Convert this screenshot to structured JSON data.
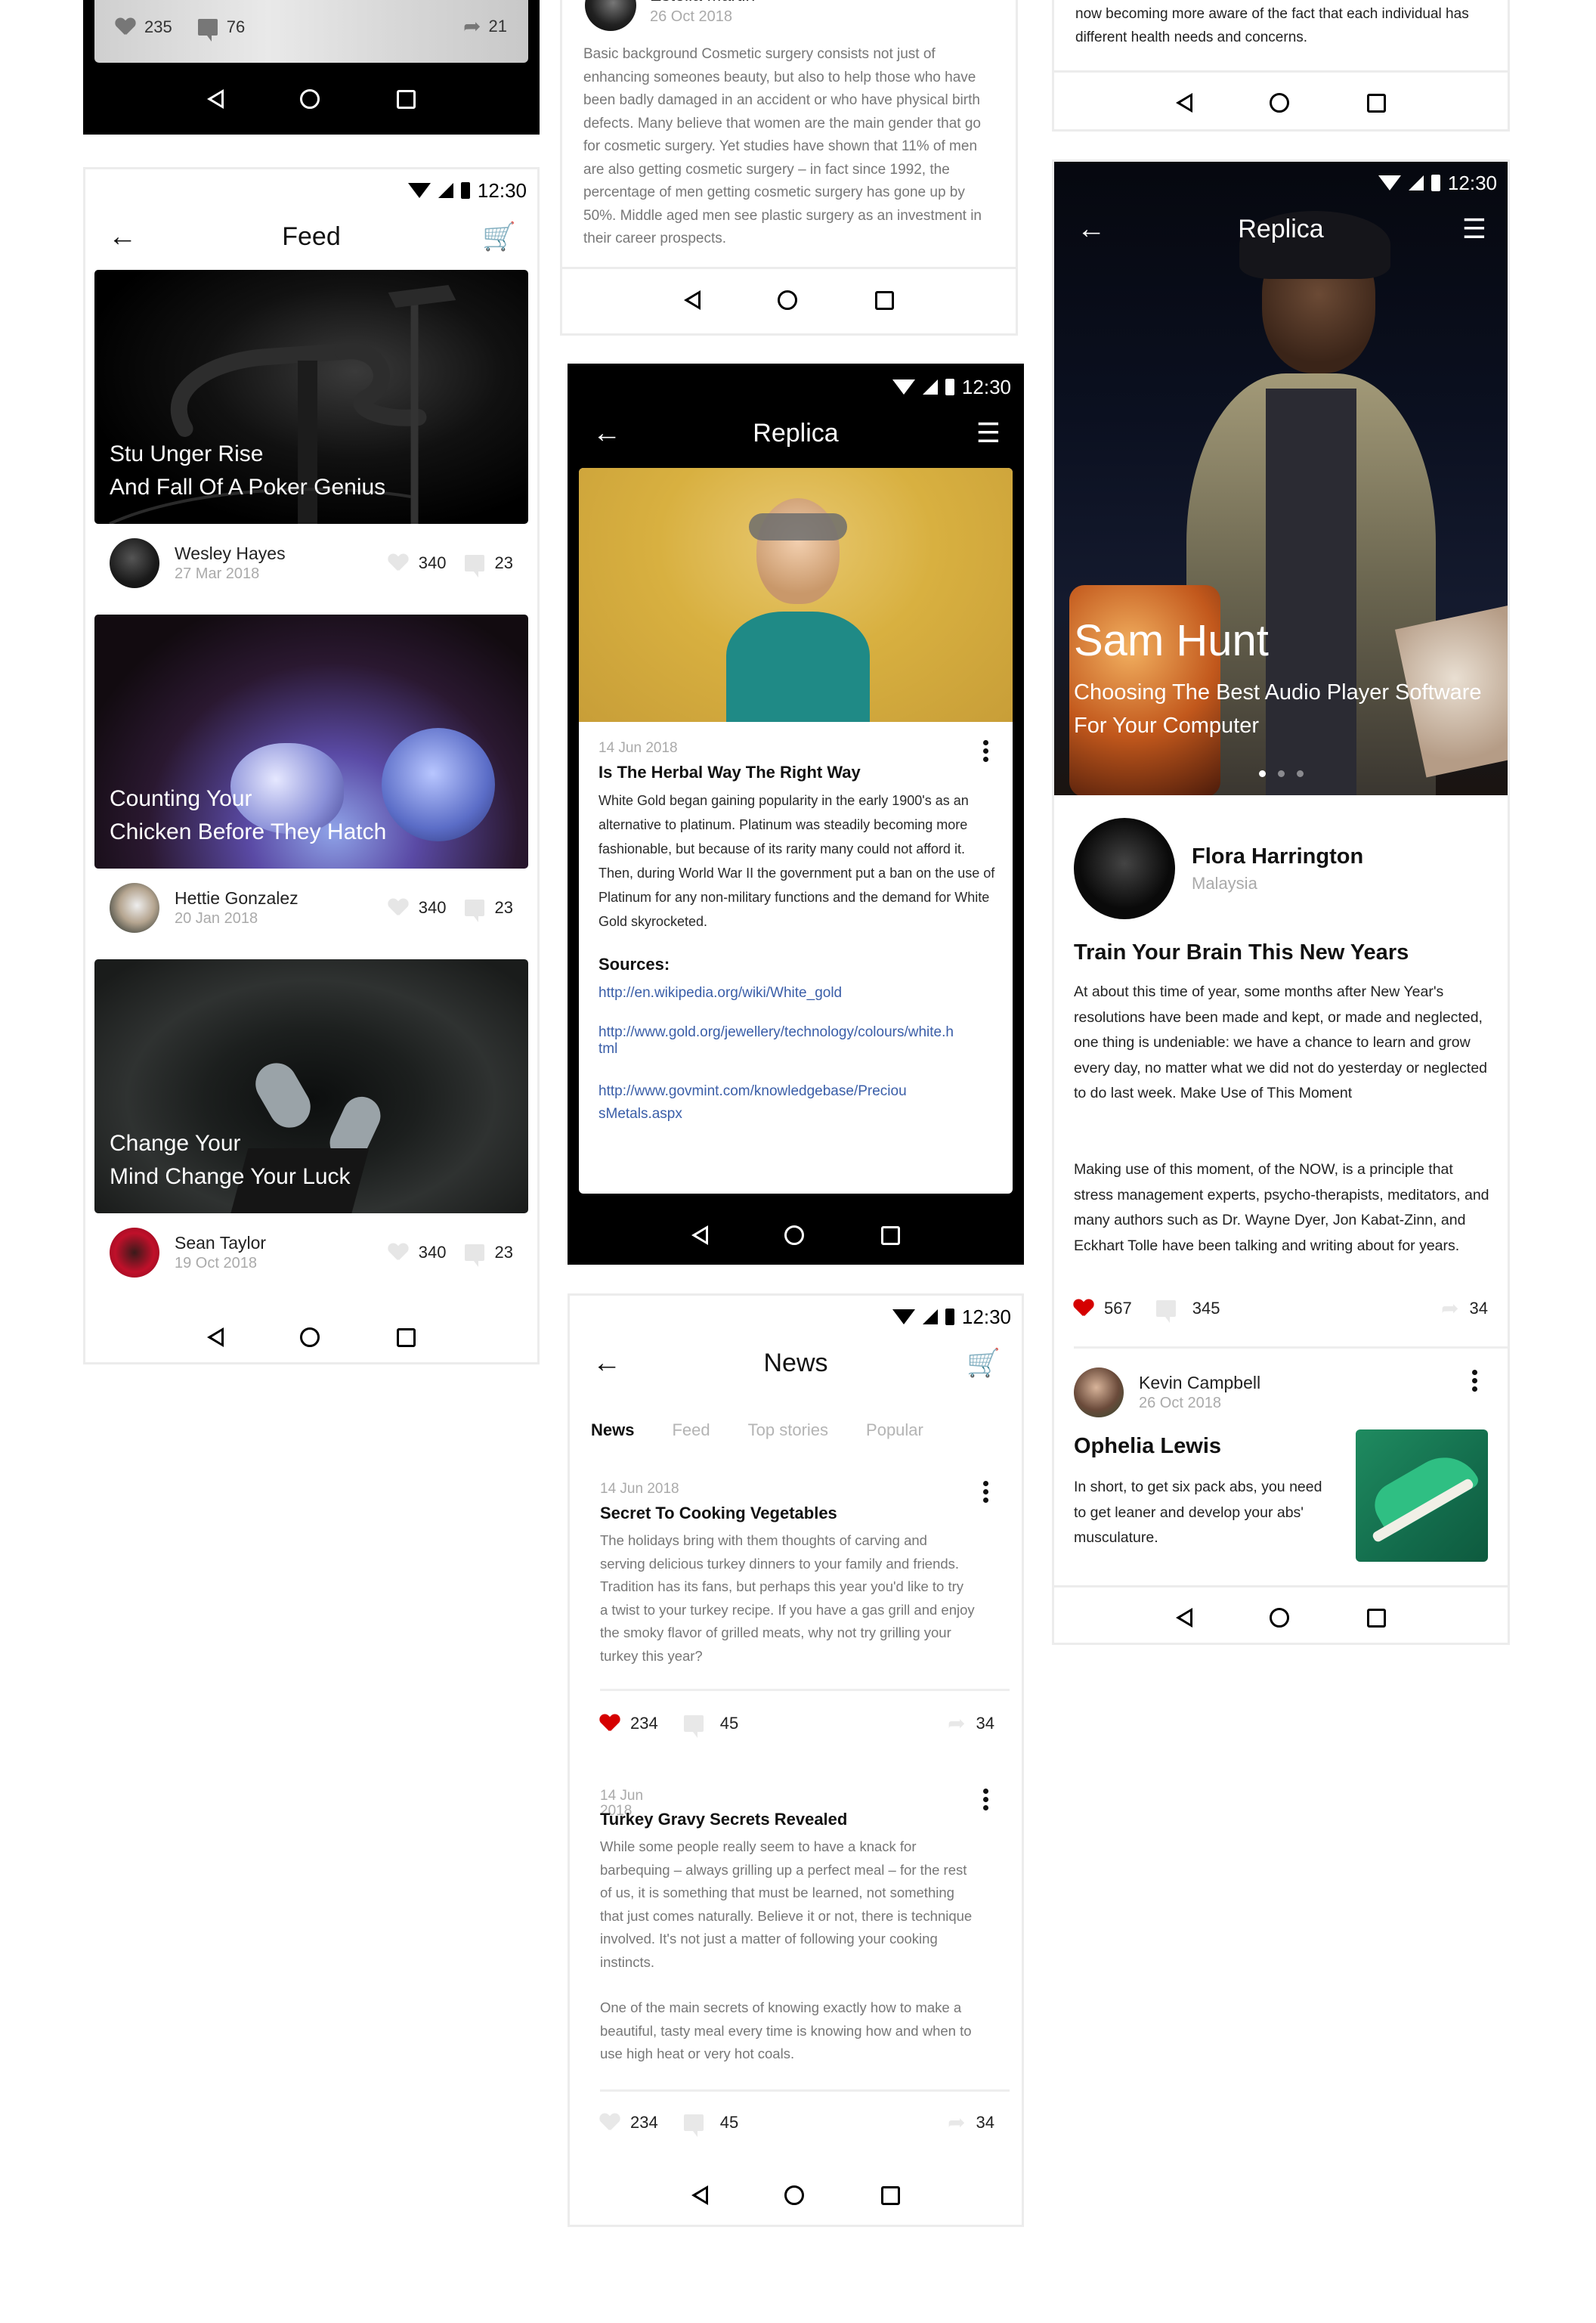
{
  "status_time": "12:30",
  "nav": {
    "back": "back",
    "home": "home",
    "recent": "recent"
  },
  "phone_a": {
    "stats": {
      "likes": "235",
      "comments": "76",
      "shares": "21"
    }
  },
  "feed": {
    "title": "Feed",
    "cards": [
      {
        "caption_line1": "Stu Unger Rise",
        "caption_line2": "And Fall Of A Poker Genius",
        "author": "Wesley Hayes",
        "date": "27 Mar 2018",
        "likes": "340",
        "comments": "23"
      },
      {
        "caption_line1": "Counting Your",
        "caption_line2": "Chicken Before They Hatch",
        "author": "Hettie Gonzalez",
        "date": "20 Jan 2018",
        "likes": "340",
        "comments": "23"
      },
      {
        "caption_line1": "Change Your",
        "caption_line2": "Mind Change Your Luck",
        "author": "Sean Taylor",
        "date": "19 Oct 2018",
        "likes": "340",
        "comments": "23"
      }
    ]
  },
  "top_card": {
    "author": "Estella Martin",
    "date": "26 Oct 2018",
    "body": "Basic background Cosmetic surgery consists not just of enhancing someones beauty, but also to help those who have been badly damaged in an accident or who have physical birth defects. Many believe that women are the main gender that go for cosmetic surgery. Yet studies have shown that 11% of men are also getting cosmetic surgery – in fact since 1992, the percentage of men getting cosmetic surgery has gone up by 50%. Middle aged men see plastic surgery as an investment in their career prospects."
  },
  "replica_article": {
    "title": "Replica",
    "date": "14 Jun 2018",
    "headline": "Is The Herbal Way The Right Way",
    "body": "White Gold began gaining popularity in the early 1900's as an alternative to platinum. Platinum was steadily becoming more fashionable, but because of its rarity many could not afford it. Then, during World War II the government put a ban on the use of Platinum for any non-military functions and the demand for White Gold skyrocketed.",
    "sources_label": "Sources:",
    "sources": [
      "http://en.wikipedia.org/wiki/White_gold",
      "http://www.gold.org/jewellery/technology/colours/white.html",
      "http://www.govmint.com/knowledgebase/PreciousMetals.aspx"
    ]
  },
  "news": {
    "title": "News",
    "tabs": [
      {
        "label": "News",
        "active": true
      },
      {
        "label": "Feed",
        "active": false
      },
      {
        "label": "Top stories",
        "active": false
      },
      {
        "label": "Popular",
        "active": false
      }
    ],
    "articles": [
      {
        "date": "14 Jun 2018",
        "headline": "Secret To Cooking Vegetables",
        "body": "The holidays bring with them thoughts of carving and serving delicious turkey dinners to your family and friends. Tradition has its fans, but perhaps this year you'd like to try a twist to your turkey recipe. If you have a gas grill and enjoy the smoky flavor of grilled meats, why not try grilling your turkey this year?",
        "likes": "234",
        "comments": "45",
        "shares": "34",
        "liked": true
      },
      {
        "date": "14 Jun 2018",
        "headline": "Turkey Gravy Secrets Revealed",
        "body": "While some people really seem to have a knack for barbequing – always grilling up a perfect meal – for the rest of us, it is something that must be learned, not something that just comes naturally. Believe it or not, there is technique involved. It's not just a matter of following your cooking instincts.",
        "body2": "One of the main secrets of knowing exactly how to make a beautiful, tasty meal every time is knowing how and when to use high heat or very hot coals.",
        "likes": "234",
        "comments": "45",
        "shares": "34",
        "liked": false
      }
    ]
  },
  "top_right": {
    "body": "now becoming more aware of the fact that each individual has different health needs and concerns."
  },
  "replica_profile": {
    "title": "Replica",
    "hero_name": "Sam Hunt",
    "hero_subtitle": "Choosing The Best Audio Player Software For Your Computer",
    "pager": {
      "count": 3,
      "active": 1
    },
    "author": "Flora Harrington",
    "location": "Malaysia",
    "headline": "Train Your Brain This New Years",
    "body1": "At about this time of year, some months after New Year's resolutions have been made and kept, or made and neglected, one thing is undeniable: we have a chance to learn and grow every day, no matter what we did not do yesterday or neglected to do last week.  Make Use of This Moment",
    "body2": "Making use of this moment, of the NOW, is a principle that stress management experts, psycho-therapists, meditators, and many authors such as Dr. Wayne Dyer, Jon Kabat-Zinn, and Eckhart Tolle have been talking and writing about for years.",
    "likes": "567",
    "comments": "345",
    "shares": "34",
    "post": {
      "author": "Kevin Campbell",
      "date": "26 Oct 2018",
      "headline": "Ophelia Lewis",
      "body": "In short, to get six pack abs, you need to get leaner and develop your abs' musculature."
    }
  },
  "colors": {
    "like_red": "#d50000",
    "link_blue": "#3a5ea8",
    "muted_text": "#777777",
    "date_grey": "#aaaaaa"
  }
}
